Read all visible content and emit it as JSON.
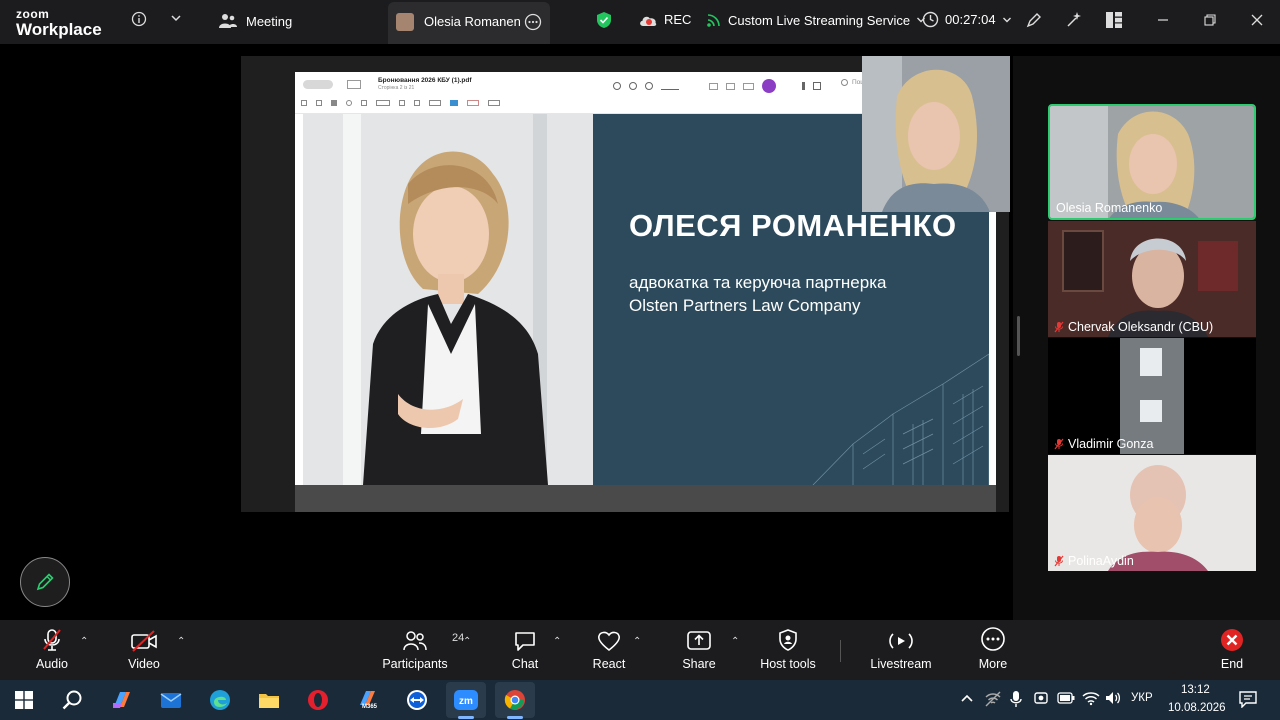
{
  "app": {
    "brand_top": "zoom",
    "brand_bottom": "Workplace"
  },
  "topbar": {
    "meeting_label": "Meeting",
    "active_tab_label": "Olesia Romanenk",
    "rec_label": "REC",
    "streaming_label": "Custom Live Streaming Service",
    "timer": "00:27:04"
  },
  "pdf": {
    "filename": "Бронювання 2026 КБУ (1).pdf",
    "page_info": "Сторінка 2 із 21",
    "search_placeholder": "Пошук"
  },
  "slide": {
    "name": "ОЛЕСЯ РОМАНЕНКО",
    "subtitle_line1": "адвокатка та керуюча партнерка",
    "subtitle_line2": "Olsten Partners Law Company",
    "bg_color": "#2c4a5c"
  },
  "participants_tiles": [
    {
      "name": "Olesia Romanenko",
      "muted": false,
      "active": true
    },
    {
      "name": "Chervak Oleksandr (CBU)",
      "muted": true,
      "active": false
    },
    {
      "name": "Vladimir Gonza",
      "muted": true,
      "active": false
    },
    {
      "name": "PolinaAydin",
      "muted": true,
      "active": false
    }
  ],
  "toolbar": {
    "audio": "Audio",
    "video": "Video",
    "participants": "Participants",
    "participants_count": "24",
    "chat": "Chat",
    "react": "React",
    "share": "Share",
    "host_tools": "Host tools",
    "livestream": "Livestream",
    "more": "More",
    "end": "End"
  },
  "taskbar": {
    "language": "УКР",
    "time": "13:12",
    "date": "10.08.2026",
    "m365_label": "M365"
  },
  "colors": {
    "active_tile_border": "#2ecc71",
    "end_red": "#e02424",
    "shield_green": "#22c55e",
    "rec_red": "#e53935"
  }
}
